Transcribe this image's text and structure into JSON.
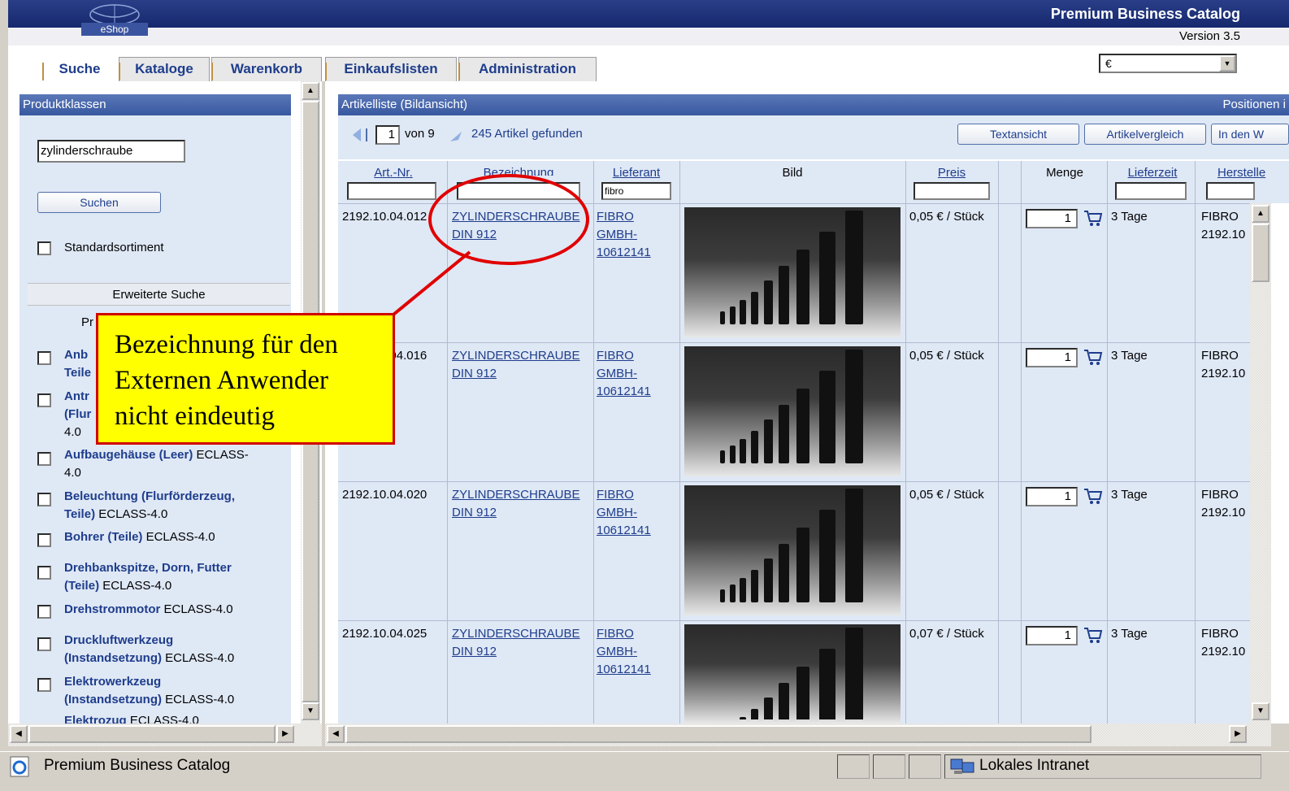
{
  "header": {
    "logo_text": "eShop",
    "brand": "Premium Business Catalog",
    "version": "Version 3.5"
  },
  "tabs": [
    {
      "label": "Suche",
      "active": true
    },
    {
      "label": "Kataloge"
    },
    {
      "label": "Warenkorb"
    },
    {
      "label": "Einkaufslisten"
    },
    {
      "label": "Administration"
    }
  ],
  "currency": {
    "selected": "€"
  },
  "left_panel": {
    "title": "Produktklassen",
    "search_value": "zylinderschraube",
    "search_button": "Suchen",
    "standard_label": "Standardsortiment",
    "extended_search": "Erweiterte Suche",
    "pk_label": "Pr",
    "classes": [
      {
        "name": "Anb",
        "line2_name": "Teile",
        "suffix": ""
      },
      {
        "name": "Antr",
        "line2_name": "(Flur",
        "line3": "4.0",
        "suffix": ""
      },
      {
        "name": "Aufbaugehäuse (Leer)",
        "suffix": " ECLASS-",
        "line2": "4.0"
      },
      {
        "name": "Beleuchtung (Flurförderzeug,",
        "line2_name": "Teile)",
        "suffix2": " ECLASS-4.0"
      },
      {
        "name": "Bohrer (Teile)",
        "suffix": " ECLASS-4.0"
      },
      {
        "name": "Drehbankspitze, Dorn, Futter",
        "line2_name": "(Teile)",
        "suffix2": " ECLASS-4.0"
      },
      {
        "name": "Drehstrommotor",
        "suffix": " ECLASS-4.0"
      },
      {
        "name": "Druckluftwerkzeug",
        "line2_name": "(Instandsetzung)",
        "suffix2": " ECLASS-4.0"
      },
      {
        "name": "Elektrowerkzeug",
        "line2_name": "(Instandsetzung)",
        "suffix2": " ECLASS-4.0"
      },
      {
        "name": "Elektrozug",
        "suffix": " ECLASS-4.0"
      }
    ]
  },
  "main": {
    "title": "Artikelliste (Bildansicht)",
    "title_right": "Positionen i",
    "pager": {
      "page": "1",
      "of": "von 9",
      "found": "245 Artikel gefunden"
    },
    "buttons": {
      "text_view": "Textansicht",
      "compare": "Artikelvergleich",
      "add": "In den W"
    },
    "columns": {
      "artnr": "Art.-Nr.",
      "bezeichnung": "Bezeichnung",
      "lieferant": "Lieferant",
      "bild": "Bild",
      "preis": "Preis",
      "menge": "Menge",
      "lieferzeit": "Lieferzeit",
      "hersteller": "Herstelle"
    },
    "filter_lieferant": "fibro",
    "rows": [
      {
        "artnr": "2192.10.04.012",
        "bez1": "ZYLINDERSCHRAUBE",
        "bez2": "DIN 912",
        "lief1": "FIBRO",
        "lief2": "GMBH-",
        "lief3": "10612141",
        "price": "0,05 € / Stück",
        "qty": "1",
        "delivery": "3 Tage",
        "mfr1": "FIBRO",
        "mfr2": "2192.10"
      },
      {
        "artnr": "2192.10.04.016",
        "bez1": "ZYLINDERSCHRAUBE",
        "bez2": "DIN 912",
        "lief1": "FIBRO",
        "lief2": "GMBH-",
        "lief3": "10612141",
        "price": "0,05 € / Stück",
        "qty": "1",
        "delivery": "3 Tage",
        "mfr1": "FIBRO",
        "mfr2": "2192.10"
      },
      {
        "artnr": "2192.10.04.020",
        "bez1": "ZYLINDERSCHRAUBE",
        "bez2": "DIN 912",
        "lief1": "FIBRO",
        "lief2": "GMBH-",
        "lief3": "10612141",
        "price": "0,05 € / Stück",
        "qty": "1",
        "delivery": "3 Tage",
        "mfr1": "FIBRO",
        "mfr2": "2192.10"
      },
      {
        "artnr": "2192.10.04.025",
        "bez1": "ZYLINDERSCHRAUBE",
        "bez2": "DIN 912",
        "lief1": "FIBRO",
        "lief2": "GMBH-",
        "lief3": "10612141",
        "price": "0,07 € / Stück",
        "qty": "1",
        "delivery": "3 Tage",
        "mfr1": "FIBRO",
        "mfr2": "2192.10"
      }
    ]
  },
  "annotation": {
    "line1": "Bezeichnung für den",
    "line2": "Externen Anwender",
    "line3": "nicht eindeutig"
  },
  "statusbar": {
    "text": "Premium Business Catalog",
    "zone": "Lokales Intranet"
  },
  "colors": {
    "link": "#1e3d8c",
    "header_bar": "#3858a0",
    "panel_bg": "#dfe8f5",
    "annotation_bg": "#ffff00",
    "annotation_border": "#d00000"
  }
}
